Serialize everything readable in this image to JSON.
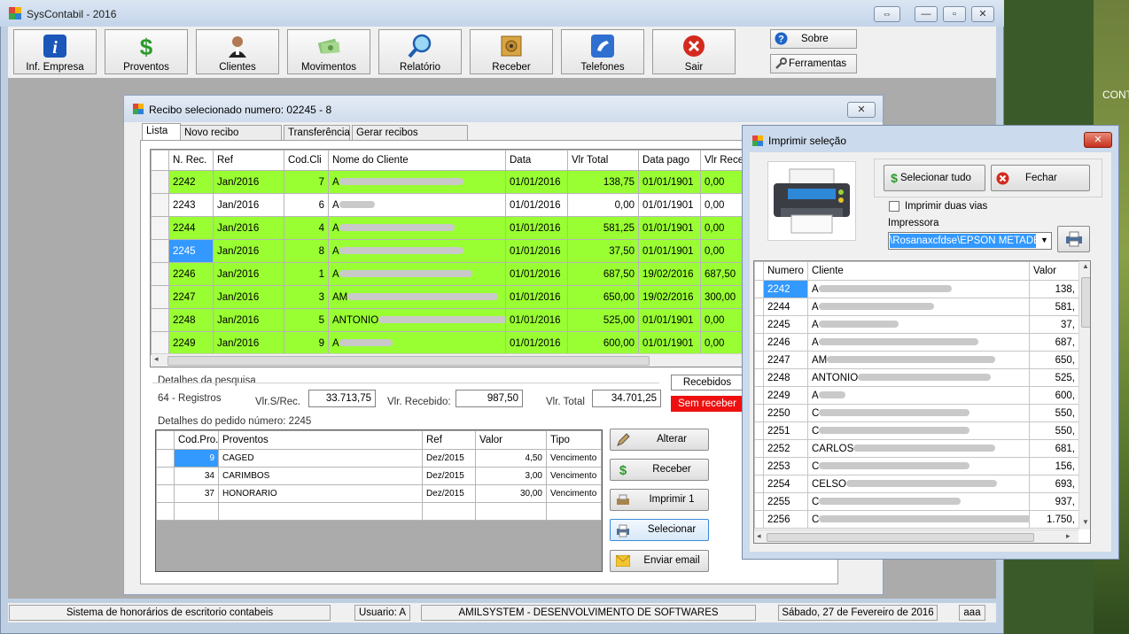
{
  "app": {
    "title": "SysContabil - 2016"
  },
  "toolbar": {
    "buttons": [
      {
        "label": "Inf. Empresa",
        "icon": "info-icon"
      },
      {
        "label": "Proventos",
        "icon": "dollar-icon"
      },
      {
        "label": "Clientes",
        "icon": "person-icon"
      },
      {
        "label": "Movimentos",
        "icon": "money-icon"
      },
      {
        "label": "Relatório",
        "icon": "magnifier-icon"
      },
      {
        "label": "Receber",
        "icon": "safe-icon"
      },
      {
        "label": "Telefones",
        "icon": "phone-icon"
      },
      {
        "label": "Sair",
        "icon": "close-red-icon"
      }
    ],
    "sobre_label": "Sobre",
    "ferramentas_label": "Ferramentas"
  },
  "desktop": {
    "text": "CONT"
  },
  "recibo_window": {
    "title": "Recibo selecionado numero: 02245 - 8",
    "tabs": [
      "Lista",
      "Novo recibo individual",
      "Transferência",
      "Gerar recibos selecionado"
    ],
    "grid": {
      "columns": [
        "N. Rec.",
        "Ref",
        "Cod.Cli",
        "Nome do Cliente",
        "Data",
        "Vlr Total",
        "Data pago",
        "Vlr Rece"
      ],
      "rows": [
        {
          "nrec": "2242",
          "ref": "Jan/2016",
          "codcli": "7",
          "nome": "A",
          "data": "01/01/2016",
          "total": "138,75",
          "pago": "01/01/1901",
          "rec": "0,00",
          "green": true
        },
        {
          "nrec": "2243",
          "ref": "Jan/2016",
          "codcli": "6",
          "nome": "A",
          "data": "01/01/2016",
          "total": "0,00",
          "pago": "01/01/1901",
          "rec": "0,00",
          "green": false
        },
        {
          "nrec": "2244",
          "ref": "Jan/2016",
          "codcli": "4",
          "nome": "A",
          "data": "01/01/2016",
          "total": "581,25",
          "pago": "01/01/1901",
          "rec": "0,00",
          "green": true
        },
        {
          "nrec": "2245",
          "ref": "Jan/2016",
          "codcli": "8",
          "nome": "A",
          "data": "01/01/2016",
          "total": "37,50",
          "pago": "01/01/1901",
          "rec": "0,00",
          "green": true
        },
        {
          "nrec": "2246",
          "ref": "Jan/2016",
          "codcli": "1",
          "nome": "A",
          "data": "01/01/2016",
          "total": "687,50",
          "pago": "19/02/2016",
          "rec": "687,50",
          "green": true
        },
        {
          "nrec": "2247",
          "ref": "Jan/2016",
          "codcli": "3",
          "nome": "AM",
          "data": "01/01/2016",
          "total": "650,00",
          "pago": "19/02/2016",
          "rec": "300,00",
          "green": true
        },
        {
          "nrec": "2248",
          "ref": "Jan/2016",
          "codcli": "5",
          "nome": "ANTONIO",
          "data": "01/01/2016",
          "total": "525,00",
          "pago": "01/01/1901",
          "rec": "0,00",
          "green": true
        },
        {
          "nrec": "2249",
          "ref": "Jan/2016",
          "codcli": "9",
          "nome": "A",
          "data": "01/01/2016",
          "total": "600,00",
          "pago": "01/01/1901",
          "rec": "0,00",
          "green": true
        }
      ]
    },
    "details": {
      "group_label": "Detalhes da pesquisa",
      "registros": "64 - Registros",
      "vlr_srec_label": "Vlr.S/Rec.",
      "vlr_srec": "33.713,75",
      "vlr_recebido_label": "Vlr. Recebido:",
      "vlr_recebido": "987,50",
      "vlr_total_label": "Vlr. Total",
      "vlr_total": "34.701,25",
      "recebidos": "Recebidos",
      "sem_receber": "Sem receber"
    },
    "pedido": {
      "group_label": "Detalhes do pedido número: 2245",
      "columns": [
        "Cod.Pro.",
        "Proventos",
        "Ref",
        "Valor",
        "Tipo"
      ],
      "rows": [
        {
          "cod": "9",
          "prov": "CAGED",
          "ref": "Dez/2015",
          "valor": "4,50",
          "tipo": "Vencimento"
        },
        {
          "cod": "34",
          "prov": "CARIMBOS",
          "ref": "Dez/2015",
          "valor": "3,00",
          "tipo": "Vencimento"
        },
        {
          "cod": "37",
          "prov": "HONORARIO",
          "ref": "Dez/2015",
          "valor": "30,00",
          "tipo": "Vencimento"
        }
      ]
    },
    "actions": {
      "alterar": "Alterar",
      "receber": "Receber",
      "imprimir": "Imprimir 1",
      "selecionar": "Selecionar",
      "email": "Enviar email"
    }
  },
  "print_dialog": {
    "title": "Imprimir seleção",
    "select_all": "Selecionar tudo",
    "close": "Fechar",
    "duas_vias": "Imprimir duas vias",
    "impressora_label": "Impressora",
    "impressora": "\\Rosanaxcfdse\\EPSON METADE",
    "columns": [
      "Numero",
      "Cliente",
      "Valor"
    ],
    "rows": [
      {
        "n": "2242",
        "c": "A",
        "v": "138,"
      },
      {
        "n": "2244",
        "c": "A",
        "v": "581,"
      },
      {
        "n": "2245",
        "c": "A",
        "v": "37,"
      },
      {
        "n": "2246",
        "c": "A",
        "v": "687,"
      },
      {
        "n": "2247",
        "c": "AM",
        "v": "650,"
      },
      {
        "n": "2248",
        "c": "ANTONIO",
        "v": "525,"
      },
      {
        "n": "2249",
        "c": "A",
        "v": "600,"
      },
      {
        "n": "2250",
        "c": "C",
        "v": "550,"
      },
      {
        "n": "2251",
        "c": "C",
        "v": "550,"
      },
      {
        "n": "2252",
        "c": "CARLOS",
        "v": "681,"
      },
      {
        "n": "2253",
        "c": "C",
        "v": "156,"
      },
      {
        "n": "2254",
        "c": "CELSO",
        "v": "693,"
      },
      {
        "n": "2255",
        "c": "C",
        "v": "937,"
      },
      {
        "n": "2256",
        "c": "C",
        "v": "1.750,"
      }
    ]
  },
  "status": {
    "sistema": "Sistema de honorários de escritorio contabeis",
    "usuario": "Usuario: A",
    "empresa": "AMILSYSTEM - DESENVOLVIMENTO DE  SOFTWARES",
    "data": "Sábado, 27 de Fevereiro de 2016",
    "extra": "aaa"
  }
}
